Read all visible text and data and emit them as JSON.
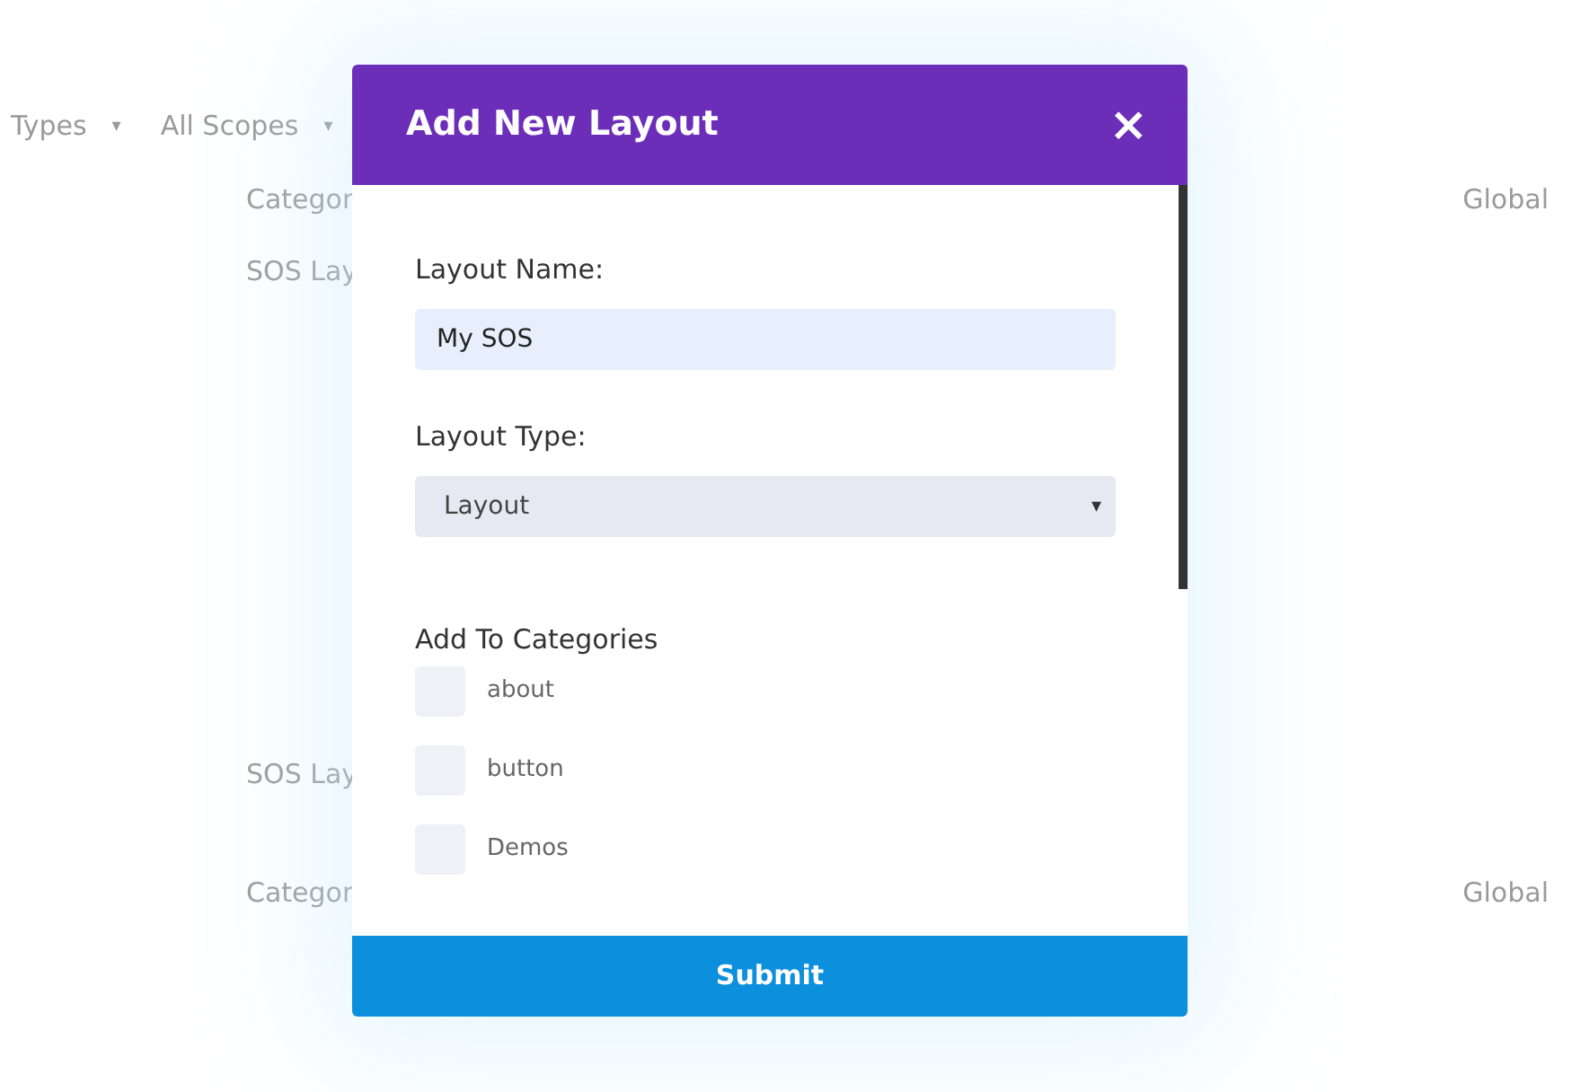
{
  "background_page": {
    "filters": [
      {
        "label": "Types",
        "caret": "▾"
      },
      {
        "label": "All Scopes",
        "caret": "▾"
      }
    ],
    "rows": [
      {
        "column_1": "Categor",
        "column_2": "Global"
      },
      {
        "column_1": "SOS Lay"
      },
      {
        "column_1": "SOS Lay"
      },
      {
        "column_1": "Categor",
        "column_2": "Global"
      }
    ]
  },
  "dialog": {
    "title": "Add New Layout",
    "close": "×",
    "name_field": {
      "label": "Layout Name:",
      "value": "My SOS"
    },
    "type_field": {
      "label": "Layout Type:",
      "value": "Layout",
      "caret": "▾"
    },
    "categories": {
      "label": "Add To Categories",
      "items": [
        {
          "label": "about",
          "checked": false
        },
        {
          "label": "button",
          "checked": false
        },
        {
          "label": "Demos",
          "checked": false
        }
      ]
    },
    "submit": "Submit"
  }
}
